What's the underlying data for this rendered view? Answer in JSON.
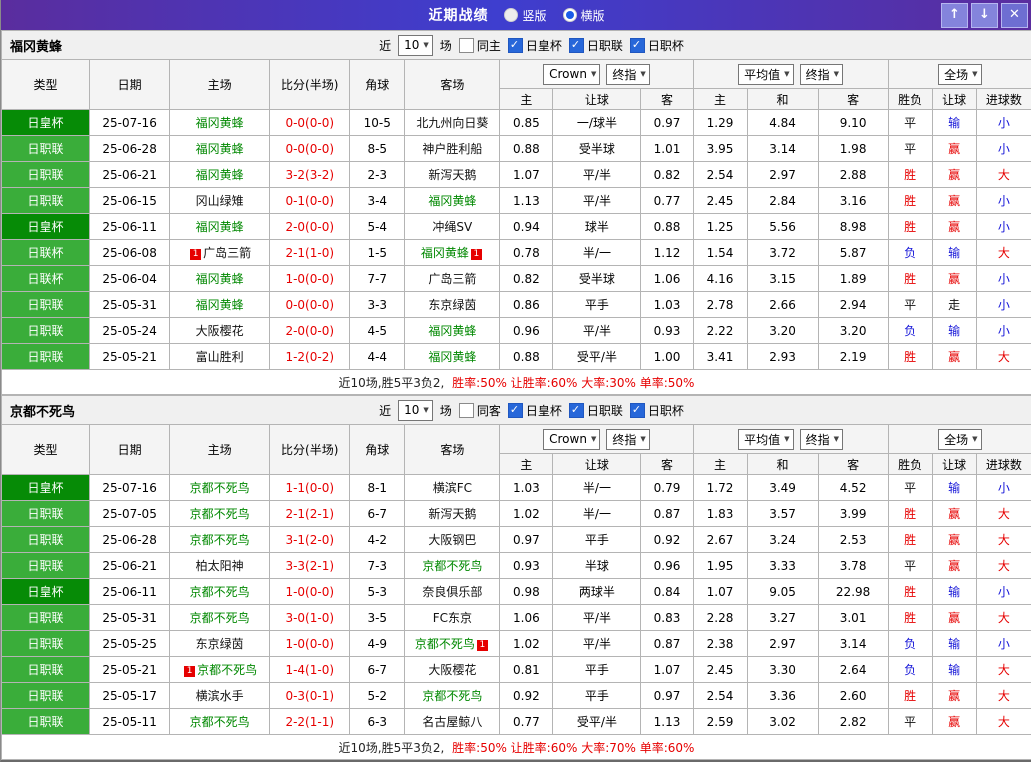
{
  "titlebar": {
    "title": "近期战绩",
    "radios": [
      {
        "label": "竖版",
        "selected": false
      },
      {
        "label": "横版",
        "selected": true
      }
    ],
    "buttons": {
      "up": "↑",
      "down": "↓",
      "close": "✕"
    }
  },
  "header": {
    "cols": [
      "类型",
      "日期",
      "主场",
      "比分(半场)",
      "角球",
      "客场"
    ],
    "odds_source": "Crown",
    "odds_time": "终指",
    "avg_source": "平均值",
    "avg_time": "终指",
    "scope": "全场",
    "sub": [
      "主",
      "让球",
      "客",
      "主",
      "和",
      "客",
      "胜负",
      "让球",
      "进球数"
    ]
  },
  "filter_labels": {
    "recent": "近",
    "count": "10",
    "games": "场"
  },
  "sections": [
    {
      "team": "福冈黄蜂",
      "same_label": "同主",
      "same_checked": false,
      "cups": [
        {
          "label": "日皇杯",
          "checked": true
        },
        {
          "label": "日职联",
          "checked": true
        },
        {
          "label": "日职杯",
          "checked": true
        }
      ],
      "footer_left": "近10场,胜5平3负2,",
      "footer_rates": "胜率:50% 让胜率:60% 大率:30% 单率:50%",
      "rows": [
        {
          "type": "日皇杯",
          "cup": "royal",
          "date": "25-07-16",
          "home": "福冈黄蜂",
          "home_self": true,
          "home_badge": "",
          "score": "0-0(0-0)",
          "corner": "10-5",
          "away": "北九州向日葵",
          "away_self": false,
          "away_badge": "",
          "odds": [
            "0.85",
            "一/球半",
            "0.97"
          ],
          "avg": [
            "1.29",
            "4.84",
            "9.10"
          ],
          "res": "平",
          "res_c": "draw",
          "han": "输",
          "han_c": "loss",
          "goal": "小",
          "goal_c": "small"
        },
        {
          "type": "日职联",
          "cup": "league",
          "date": "25-06-28",
          "home": "福冈黄蜂",
          "home_self": true,
          "home_badge": "",
          "score": "0-0(0-0)",
          "corner": "8-5",
          "away": "神户胜利船",
          "away_self": false,
          "away_badge": "",
          "odds": [
            "0.88",
            "受半球",
            "1.01"
          ],
          "avg": [
            "3.95",
            "3.14",
            "1.98"
          ],
          "res": "平",
          "res_c": "draw",
          "han": "赢",
          "han_c": "win",
          "goal": "小",
          "goal_c": "small"
        },
        {
          "type": "日职联",
          "cup": "league",
          "date": "25-06-21",
          "home": "福冈黄蜂",
          "home_self": true,
          "home_badge": "",
          "score": "3-2(3-2)",
          "corner": "2-3",
          "away": "新泻天鹅",
          "away_self": false,
          "away_badge": "",
          "odds": [
            "1.07",
            "平/半",
            "0.82"
          ],
          "avg": [
            "2.54",
            "2.97",
            "2.88"
          ],
          "res": "胜",
          "res_c": "win",
          "han": "赢",
          "han_c": "win",
          "goal": "大",
          "goal_c": "big"
        },
        {
          "type": "日职联",
          "cup": "league",
          "date": "25-06-15",
          "home": "冈山绿雉",
          "home_self": false,
          "home_badge": "",
          "score": "0-1(0-0)",
          "corner": "3-4",
          "away": "福冈黄蜂",
          "away_self": true,
          "away_badge": "",
          "odds": [
            "1.13",
            "平/半",
            "0.77"
          ],
          "avg": [
            "2.45",
            "2.84",
            "3.16"
          ],
          "res": "胜",
          "res_c": "win",
          "han": "赢",
          "han_c": "win",
          "goal": "小",
          "goal_c": "small"
        },
        {
          "type": "日皇杯",
          "cup": "royal",
          "date": "25-06-11",
          "home": "福冈黄蜂",
          "home_self": true,
          "home_badge": "",
          "score": "2-0(0-0)",
          "corner": "5-4",
          "away": "冲绳SV",
          "away_self": false,
          "away_badge": "",
          "odds": [
            "0.94",
            "球半",
            "0.88"
          ],
          "avg": [
            "1.25",
            "5.56",
            "8.98"
          ],
          "res": "胜",
          "res_c": "win",
          "han": "赢",
          "han_c": "win",
          "goal": "小",
          "goal_c": "small"
        },
        {
          "type": "日联杯",
          "cup": "lcup",
          "date": "25-06-08",
          "home": "广岛三箭",
          "home_self": false,
          "home_badge": "1",
          "score": "2-1(1-0)",
          "corner": "1-5",
          "away": "福冈黄蜂",
          "away_self": true,
          "away_badge": "1",
          "odds": [
            "0.78",
            "半/一",
            "1.12"
          ],
          "avg": [
            "1.54",
            "3.72",
            "5.87"
          ],
          "res": "负",
          "res_c": "loss",
          "han": "输",
          "han_c": "loss",
          "goal": "大",
          "goal_c": "big"
        },
        {
          "type": "日联杯",
          "cup": "lcup",
          "date": "25-06-04",
          "home": "福冈黄蜂",
          "home_self": true,
          "home_badge": "",
          "score": "1-0(0-0)",
          "corner": "7-7",
          "away": "广岛三箭",
          "away_self": false,
          "away_badge": "",
          "odds": [
            "0.82",
            "受半球",
            "1.06"
          ],
          "avg": [
            "4.16",
            "3.15",
            "1.89"
          ],
          "res": "胜",
          "res_c": "win",
          "han": "赢",
          "han_c": "win",
          "goal": "小",
          "goal_c": "small"
        },
        {
          "type": "日职联",
          "cup": "league",
          "date": "25-05-31",
          "home": "福冈黄蜂",
          "home_self": true,
          "home_badge": "",
          "score": "0-0(0-0)",
          "corner": "3-3",
          "away": "东京绿茵",
          "away_self": false,
          "away_badge": "",
          "odds": [
            "0.86",
            "平手",
            "1.03"
          ],
          "avg": [
            "2.78",
            "2.66",
            "2.94"
          ],
          "res": "平",
          "res_c": "draw",
          "han": "走",
          "han_c": "push",
          "goal": "小",
          "goal_c": "small"
        },
        {
          "type": "日职联",
          "cup": "league",
          "date": "25-05-24",
          "home": "大阪樱花",
          "home_self": false,
          "home_badge": "",
          "score": "2-0(0-0)",
          "corner": "4-5",
          "away": "福冈黄蜂",
          "away_self": true,
          "away_badge": "",
          "odds": [
            "0.96",
            "平/半",
            "0.93"
          ],
          "avg": [
            "2.22",
            "3.20",
            "3.20"
          ],
          "res": "负",
          "res_c": "loss",
          "han": "输",
          "han_c": "loss",
          "goal": "小",
          "goal_c": "small"
        },
        {
          "type": "日职联",
          "cup": "league",
          "date": "25-05-21",
          "home": "富山胜利",
          "home_self": false,
          "home_badge": "",
          "score": "1-2(0-2)",
          "corner": "4-4",
          "away": "福冈黄蜂",
          "away_self": true,
          "away_badge": "",
          "odds": [
            "0.88",
            "受平/半",
            "1.00"
          ],
          "avg": [
            "3.41",
            "2.93",
            "2.19"
          ],
          "res": "胜",
          "res_c": "win",
          "han": "赢",
          "han_c": "win",
          "goal": "大",
          "goal_c": "big"
        }
      ]
    },
    {
      "team": "京都不死鸟",
      "same_label": "同客",
      "same_checked": false,
      "cups": [
        {
          "label": "日皇杯",
          "checked": true
        },
        {
          "label": "日职联",
          "checked": true
        },
        {
          "label": "日职杯",
          "checked": true
        }
      ],
      "footer_left": "近10场,胜5平3负2,",
      "footer_rates": "胜率:50% 让胜率:60% 大率:70% 单率:60%",
      "rows": [
        {
          "type": "日皇杯",
          "cup": "royal",
          "date": "25-07-16",
          "home": "京都不死鸟",
          "home_self": true,
          "home_badge": "",
          "score": "1-1(0-0)",
          "corner": "8-1",
          "away": "横滨FC",
          "away_self": false,
          "away_badge": "",
          "odds": [
            "1.03",
            "半/一",
            "0.79"
          ],
          "avg": [
            "1.72",
            "3.49",
            "4.52"
          ],
          "res": "平",
          "res_c": "draw",
          "han": "输",
          "han_c": "loss",
          "goal": "小",
          "goal_c": "small"
        },
        {
          "type": "日职联",
          "cup": "league",
          "date": "25-07-05",
          "home": "京都不死鸟",
          "home_self": true,
          "home_badge": "",
          "score": "2-1(2-1)",
          "corner": "6-7",
          "away": "新泻天鹅",
          "away_self": false,
          "away_badge": "",
          "odds": [
            "1.02",
            "半/一",
            "0.87"
          ],
          "avg": [
            "1.83",
            "3.57",
            "3.99"
          ],
          "res": "胜",
          "res_c": "win",
          "han": "赢",
          "han_c": "win",
          "goal": "大",
          "goal_c": "big"
        },
        {
          "type": "日职联",
          "cup": "league",
          "date": "25-06-28",
          "home": "京都不死鸟",
          "home_self": true,
          "home_badge": "",
          "score": "3-1(2-0)",
          "corner": "4-2",
          "away": "大阪钢巴",
          "away_self": false,
          "away_badge": "",
          "odds": [
            "0.97",
            "平手",
            "0.92"
          ],
          "avg": [
            "2.67",
            "3.24",
            "2.53"
          ],
          "res": "胜",
          "res_c": "win",
          "han": "赢",
          "han_c": "win",
          "goal": "大",
          "goal_c": "big"
        },
        {
          "type": "日职联",
          "cup": "league",
          "date": "25-06-21",
          "home": "柏太阳神",
          "home_self": false,
          "home_badge": "",
          "score": "3-3(2-1)",
          "corner": "7-3",
          "away": "京都不死鸟",
          "away_self": true,
          "away_badge": "",
          "odds": [
            "0.93",
            "半球",
            "0.96"
          ],
          "avg": [
            "1.95",
            "3.33",
            "3.78"
          ],
          "res": "平",
          "res_c": "draw",
          "han": "赢",
          "han_c": "win",
          "goal": "大",
          "goal_c": "big"
        },
        {
          "type": "日皇杯",
          "cup": "royal",
          "date": "25-06-11",
          "home": "京都不死鸟",
          "home_self": true,
          "home_badge": "",
          "score": "1-0(0-0)",
          "corner": "5-3",
          "away": "奈良俱乐部",
          "away_self": false,
          "away_badge": "",
          "odds": [
            "0.98",
            "两球半",
            "0.84"
          ],
          "avg": [
            "1.07",
            "9.05",
            "22.98"
          ],
          "res": "胜",
          "res_c": "win",
          "han": "输",
          "han_c": "loss",
          "goal": "小",
          "goal_c": "small"
        },
        {
          "type": "日职联",
          "cup": "league",
          "date": "25-05-31",
          "home": "京都不死鸟",
          "home_self": true,
          "home_badge": "",
          "score": "3-0(1-0)",
          "corner": "3-5",
          "away": "FC东京",
          "away_self": false,
          "away_badge": "",
          "odds": [
            "1.06",
            "平/半",
            "0.83"
          ],
          "avg": [
            "2.28",
            "3.27",
            "3.01"
          ],
          "res": "胜",
          "res_c": "win",
          "han": "赢",
          "han_c": "win",
          "goal": "大",
          "goal_c": "big"
        },
        {
          "type": "日职联",
          "cup": "league",
          "date": "25-05-25",
          "home": "东京绿茵",
          "home_self": false,
          "home_badge": "",
          "score": "1-0(0-0)",
          "corner": "4-9",
          "away": "京都不死鸟",
          "away_self": true,
          "away_badge": "1",
          "odds": [
            "1.02",
            "平/半",
            "0.87"
          ],
          "avg": [
            "2.38",
            "2.97",
            "3.14"
          ],
          "res": "负",
          "res_c": "loss",
          "han": "输",
          "han_c": "loss",
          "goal": "小",
          "goal_c": "small"
        },
        {
          "type": "日职联",
          "cup": "league",
          "date": "25-05-21",
          "home": "京都不死鸟",
          "home_self": true,
          "home_badge": "1",
          "score": "1-4(1-0)",
          "corner": "6-7",
          "away": "大阪樱花",
          "away_self": false,
          "away_badge": "",
          "odds": [
            "0.81",
            "平手",
            "1.07"
          ],
          "avg": [
            "2.45",
            "3.30",
            "2.64"
          ],
          "res": "负",
          "res_c": "loss",
          "han": "输",
          "han_c": "loss",
          "goal": "大",
          "goal_c": "big"
        },
        {
          "type": "日职联",
          "cup": "league",
          "date": "25-05-17",
          "home": "横滨水手",
          "home_self": false,
          "home_badge": "",
          "score": "0-3(0-1)",
          "corner": "5-2",
          "away": "京都不死鸟",
          "away_self": true,
          "away_badge": "",
          "odds": [
            "0.92",
            "平手",
            "0.97"
          ],
          "avg": [
            "2.54",
            "3.36",
            "2.60"
          ],
          "res": "胜",
          "res_c": "win",
          "han": "赢",
          "han_c": "win",
          "goal": "大",
          "goal_c": "big"
        },
        {
          "type": "日职联",
          "cup": "league",
          "date": "25-05-11",
          "home": "京都不死鸟",
          "home_self": true,
          "home_badge": "",
          "score": "2-2(1-1)",
          "corner": "6-3",
          "away": "名古屋鲸八",
          "away_self": false,
          "away_badge": "",
          "odds": [
            "0.77",
            "受平/半",
            "1.13"
          ],
          "avg": [
            "2.59",
            "3.02",
            "2.82"
          ],
          "res": "平",
          "res_c": "draw",
          "han": "赢",
          "han_c": "win",
          "goal": "大",
          "goal_c": "big"
        }
      ]
    }
  ]
}
